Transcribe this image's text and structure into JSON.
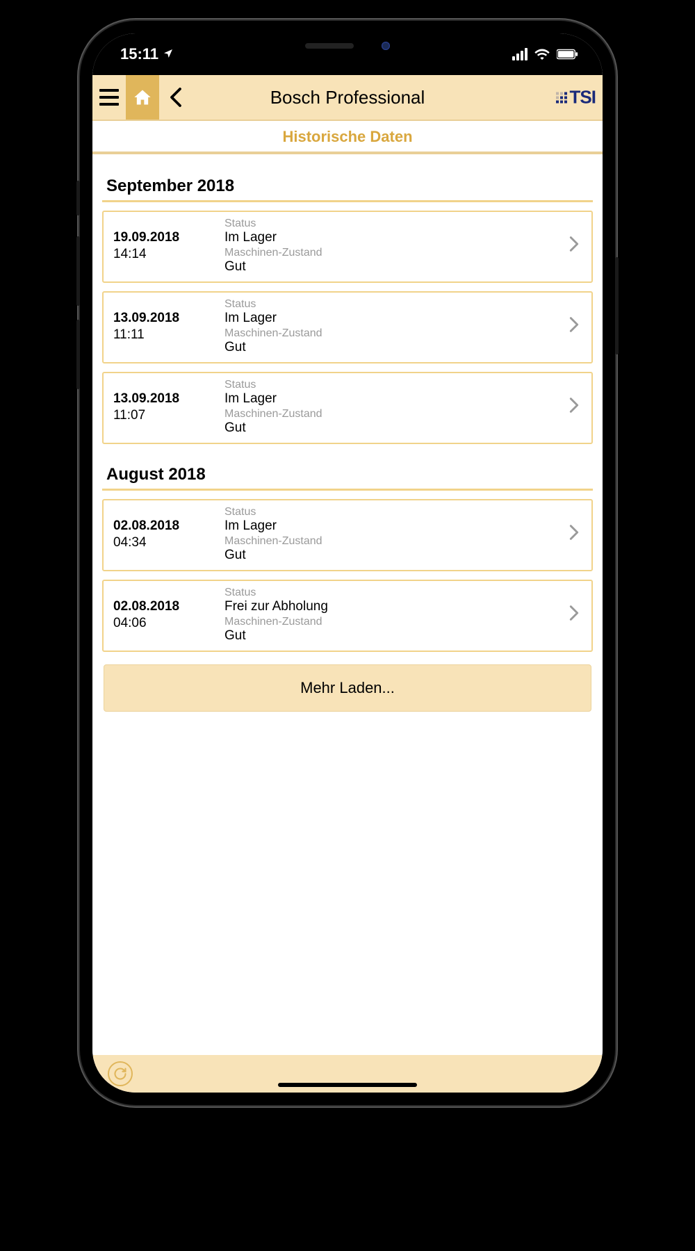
{
  "statusbar": {
    "time": "15:11"
  },
  "navbar": {
    "title": "Bosch Professional",
    "logo_text": "TSI"
  },
  "section_title": "Historische Daten",
  "labels": {
    "status": "Status",
    "machine_state": "Maschinen-Zustand"
  },
  "load_more": "Mehr Laden...",
  "groups": [
    {
      "month": "September 2018",
      "entries": [
        {
          "date": "19.09.2018",
          "time": "14:14",
          "status": "Im Lager",
          "state": "Gut"
        },
        {
          "date": "13.09.2018",
          "time": "11:11",
          "status": "Im Lager",
          "state": "Gut"
        },
        {
          "date": "13.09.2018",
          "time": "11:07",
          "status": "Im Lager",
          "state": "Gut"
        }
      ]
    },
    {
      "month": "August 2018",
      "entries": [
        {
          "date": "02.08.2018",
          "time": "04:34",
          "status": "Im Lager",
          "state": "Gut"
        },
        {
          "date": "02.08.2018",
          "time": "04:06",
          "status": "Frei zur Abholung",
          "state": "Gut"
        }
      ]
    }
  ]
}
